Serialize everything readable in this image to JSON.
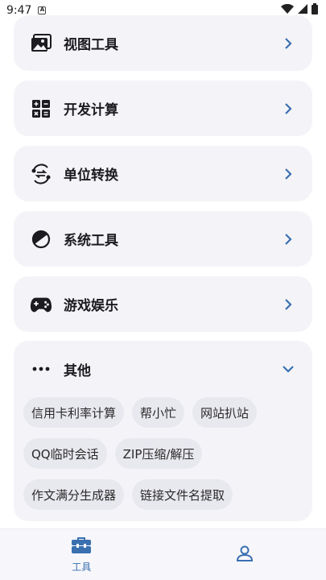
{
  "status_bar": {
    "time": "9:47",
    "notif_letter": "A"
  },
  "categories": [
    {
      "label": "视图工具",
      "icon": "image-icon"
    },
    {
      "label": "开发计算",
      "icon": "calculator-icon"
    },
    {
      "label": "单位转换",
      "icon": "convert-icon"
    },
    {
      "label": "系统工具",
      "icon": "contrast-icon"
    },
    {
      "label": "游戏娱乐",
      "icon": "gamepad-icon"
    }
  ],
  "other": {
    "label": "其他",
    "icon": "more-dots-icon",
    "chips": [
      [
        "信用卡利率计算",
        "帮小忙",
        "网站扒站"
      ],
      [
        "QQ临时会话",
        "ZIP压缩/解压"
      ],
      [
        "作文满分生成器",
        "链接文件名提取"
      ]
    ]
  },
  "nav": {
    "tools_label": "工具",
    "accent": "#3a6fb0"
  }
}
